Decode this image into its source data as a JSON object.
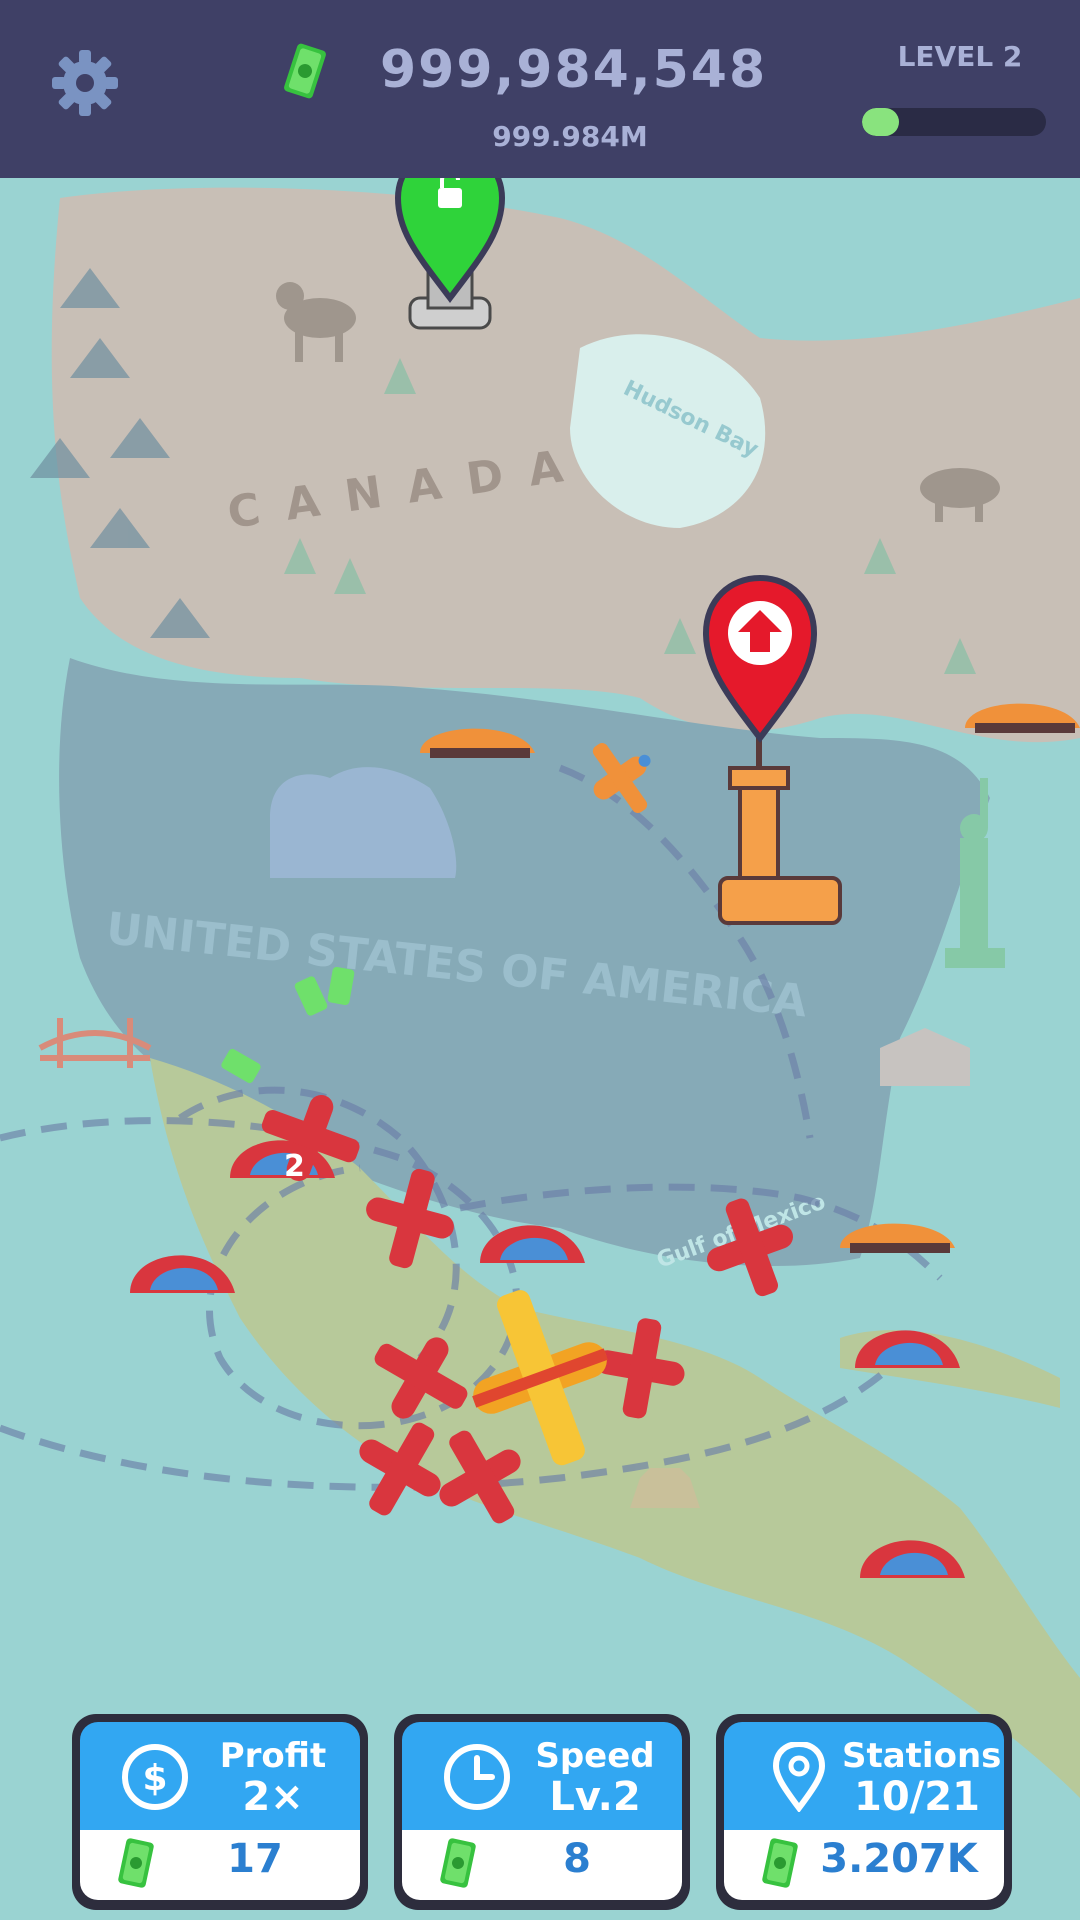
{
  "header": {
    "money": "999,984,548",
    "money_short": "999.984M",
    "level": "LEVEL 2",
    "level_progress": 0.2
  },
  "map": {
    "labels": {
      "country_north": "CANADA",
      "country_main": "UNITED STATES OF AMERICA",
      "bay": "Hudson Bay",
      "gulf": "Gulf of Mexico"
    },
    "badges": {
      "plane_count": "2"
    }
  },
  "buttons": [
    {
      "title": "Profit",
      "value": "2×",
      "price": "17",
      "icon": "dollar-icon"
    },
    {
      "title": "Speed",
      "value": "Lv.2",
      "price": "8",
      "icon": "clock-icon"
    },
    {
      "title": "Stations",
      "value": "10/21",
      "price": "3.207K",
      "icon": "location-pin-icon"
    }
  ],
  "colors": {
    "header_bg": "#3f4066",
    "button_blue": "#32a7f2",
    "unlock_pin": "#2fd33a",
    "upgrade_pin": "#e5192b",
    "plane_red": "#d9363e",
    "plane_gold": "#f2a323"
  }
}
